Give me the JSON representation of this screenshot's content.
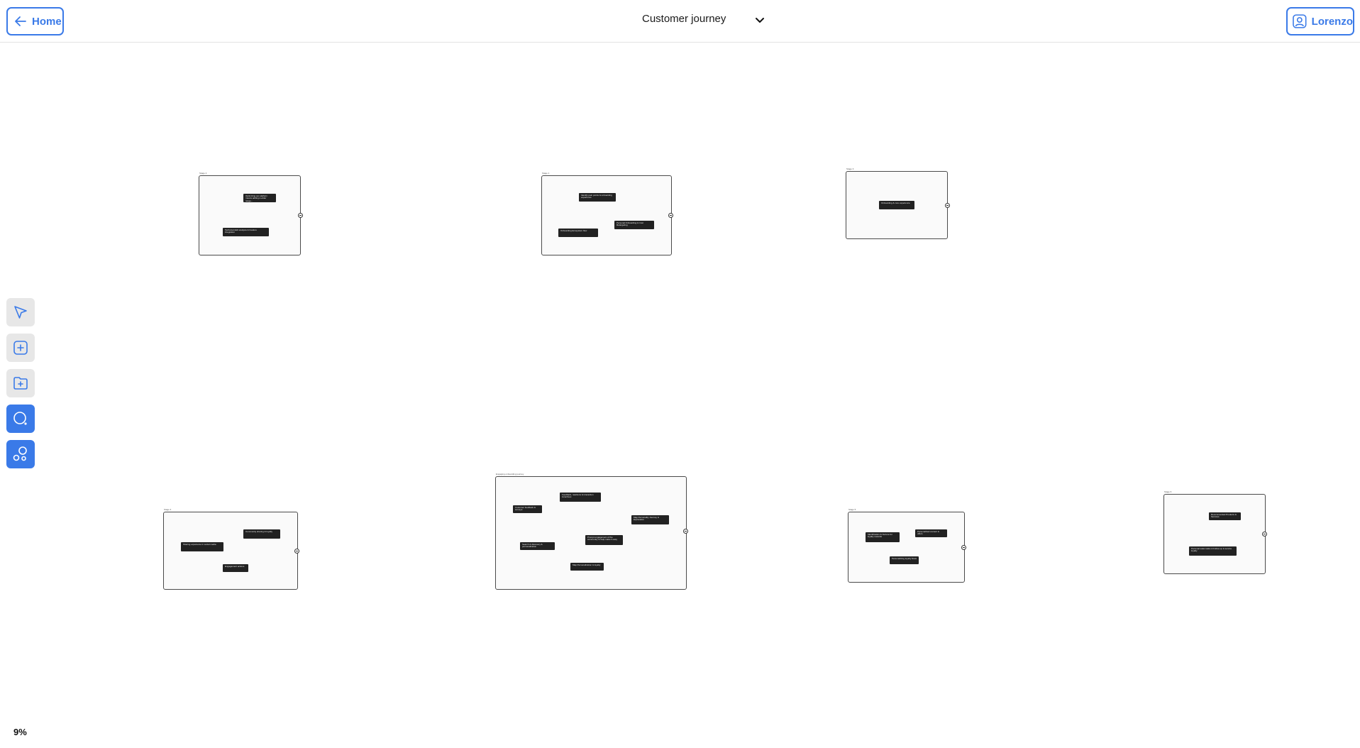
{
  "header": {
    "home_label": "Home",
    "title": "Customer journey",
    "user_label": "Lorenzo"
  },
  "toolbar": {
    "items": [
      {
        "name": "select-tool",
        "icon": "cursor-arrow-icon"
      },
      {
        "name": "add-node",
        "icon": "plus-square-icon"
      },
      {
        "name": "add-group",
        "icon": "folder-plus-icon"
      },
      {
        "name": "search",
        "icon": "search-icon"
      },
      {
        "name": "cluster",
        "icon": "bubbles-icon"
      }
    ]
  },
  "canvas": {
    "zoom": "9%",
    "groups": [
      {
        "label": "Stage 2",
        "cards": [
          "Optimizing our platform means adding a wider range...",
          "Technical debt analysis & Feature integration"
        ]
      },
      {
        "label": "Stage 1",
        "cards": [
          "Identify pain points & onboarding experience",
          "Personal Onboarding & trust Retargeting",
          "Onboarding Ecosystem flow"
        ]
      },
      {
        "label": "Stage 3",
        "cards": [
          "Onboarding & core experience"
        ]
      },
      {
        "label": "Stage 4",
        "cards": [
          "Community sharing & loyalty",
          "Sharing experience in social media",
          "Engagement actions"
        ]
      },
      {
        "label": "Engaging onboarding journey",
        "cards": [
          "Feedback, reactions & interaction incentives",
          "Customer feedback & surveys",
          "Map Personality Journey & Exploration",
          "Prompt engagement of the community to help make it easy",
          "Search & discovery & personalization",
          "Map Personalization & loyalty"
        ]
      },
      {
        "label": "Stage 5",
        "cards": [
          "Identification & Nurture for loyalty rewards",
          "Personalized content & offers",
          "Personalizing loyalty flows"
        ]
      },
      {
        "label": "Stage 6",
        "cards": [
          "Recommended Products & Services",
          "Personal sales tasks & Follow up & service loyalty"
        ]
      }
    ]
  }
}
